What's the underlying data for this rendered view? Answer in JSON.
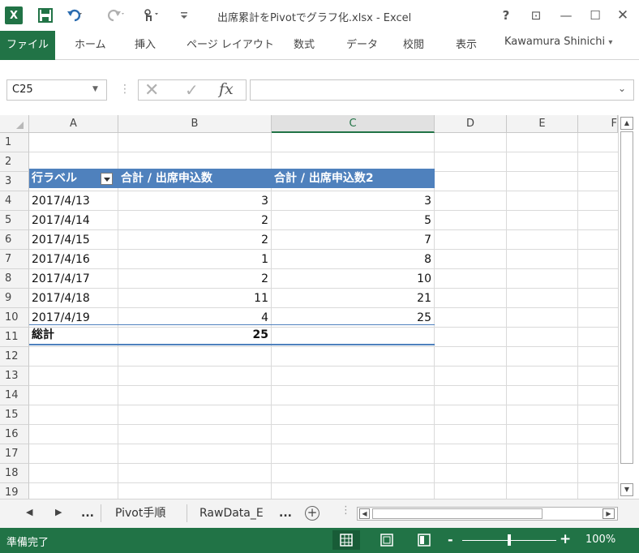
{
  "app": {
    "title": "出席累計をPivotでグラフ化.xlsx - Excel",
    "logo_letter": "X",
    "help_label": "?",
    "ribbon_options_icon": "⊡",
    "minimize_icon": "—",
    "maximize_icon": "☐",
    "close_icon": "✕"
  },
  "quick_access": {
    "save_icon": "save-icon",
    "undo_icon": "undo-icon",
    "redo_icon": "redo-icon",
    "touch_icon": "touch-mode-icon",
    "customize_icon": "customize-icon"
  },
  "ribbon": {
    "tabs": [
      "ファイル",
      "ホーム",
      "挿入",
      "ページ レイアウト",
      "数式",
      "データ",
      "校閲",
      "表示"
    ],
    "user": "Kawamura Shinichi",
    "user_arrow": "▾"
  },
  "formula_bar": {
    "name_box": "C25",
    "name_arrow": "▼",
    "separator": "⋮",
    "cancel": "✕",
    "enter": "✓",
    "fx": "fx",
    "value": "",
    "expand": "⌄"
  },
  "columns": [
    "A",
    "B",
    "C",
    "D",
    "E",
    "F"
  ],
  "selected_column": "C",
  "rows": [
    "1",
    "2",
    "3",
    "4",
    "5",
    "6",
    "7",
    "8",
    "9",
    "10",
    "11",
    "12",
    "13",
    "14",
    "15",
    "16",
    "17",
    "18",
    "19"
  ],
  "pivot": {
    "headers": [
      "行ラベル",
      "合計 / 出席申込数",
      "合計 / 出席申込数2"
    ],
    "rows": [
      {
        "label": "2017/4/13",
        "count": "3",
        "cumulative": "3"
      },
      {
        "label": "2017/4/14",
        "count": "2",
        "cumulative": "5"
      },
      {
        "label": "2017/4/15",
        "count": "2",
        "cumulative": "7"
      },
      {
        "label": "2017/4/16",
        "count": "1",
        "cumulative": "8"
      },
      {
        "label": "2017/4/17",
        "count": "2",
        "cumulative": "10"
      },
      {
        "label": "2017/4/18",
        "count": "11",
        "cumulative": "21"
      },
      {
        "label": "2017/4/19",
        "count": "4",
        "cumulative": "25"
      }
    ],
    "total_label": "総計",
    "total_count": "25",
    "header_color": "#4F81BD"
  },
  "sheets": {
    "nav_prev": "◀",
    "nav_next": "▶",
    "more_left": "...",
    "tabs": [
      "Pivot手順",
      "RawData_E"
    ],
    "more_right": "...",
    "add": "+",
    "options": "⋮"
  },
  "scroll": {
    "up": "▲",
    "down": "▼",
    "left": "◀",
    "right": "▶"
  },
  "status": {
    "text": "準備完了",
    "zoom_minus": "-",
    "zoom_plus": "+",
    "zoom": "100%",
    "zoom_fraction": 0.5
  },
  "colors": {
    "excel_green": "#217346",
    "pivot_blue": "#4F81BD"
  }
}
